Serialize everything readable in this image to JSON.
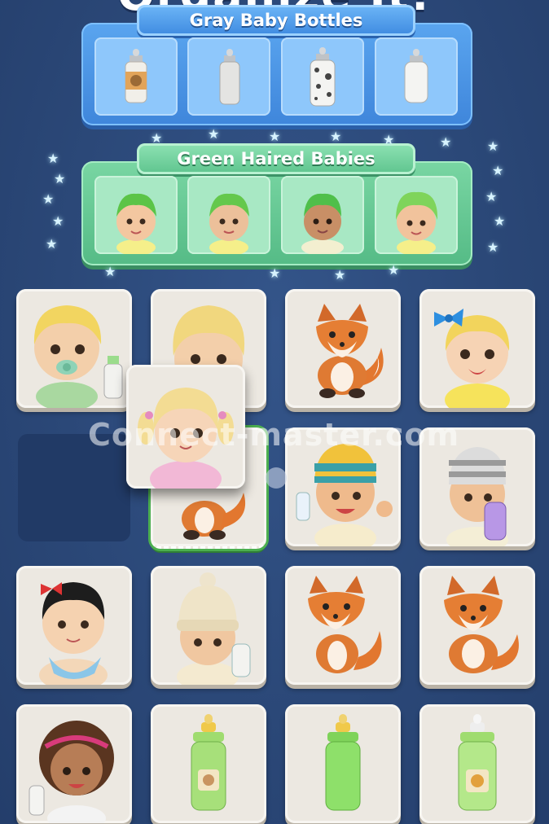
{
  "header": {
    "title": "Organize It!"
  },
  "watermark": "Connect-master.com",
  "groups": [
    {
      "label": "Gray Baby Bottles",
      "items": [
        "bottle-bear-icon",
        "bottle-plain-icon",
        "bottle-spotted-icon",
        "bottle-white-icon"
      ]
    },
    {
      "label": "Green Haired Babies",
      "items": [
        "baby-green-hair-icon",
        "baby-green-hair-icon",
        "baby-green-hair-icon",
        "baby-green-hair-icon"
      ]
    }
  ],
  "board": {
    "rows": [
      [
        "baby-blonde-pacifier-icon",
        "baby-blonde-curly-icon",
        "fox-icon",
        "baby-blue-bow-icon"
      ],
      [
        "empty",
        "fox-icon",
        "baby-striped-beanie-icon",
        "baby-gray-beanie-icon"
      ],
      [
        "baby-black-hair-bib-icon",
        "baby-knit-hat-icon",
        "fox-icon",
        "fox-icon"
      ],
      [
        "baby-curly-headband-icon",
        "bottle-green-bear-icon",
        "bottle-green-plain-icon",
        "bottle-green-lion-icon"
      ]
    ],
    "dragging": "baby-blonde-pigtails-icon"
  },
  "colors": {
    "background": "#2b4878",
    "blue_group": "#4a96e6",
    "green_group": "#62c490",
    "tile": "#ece8e1"
  }
}
